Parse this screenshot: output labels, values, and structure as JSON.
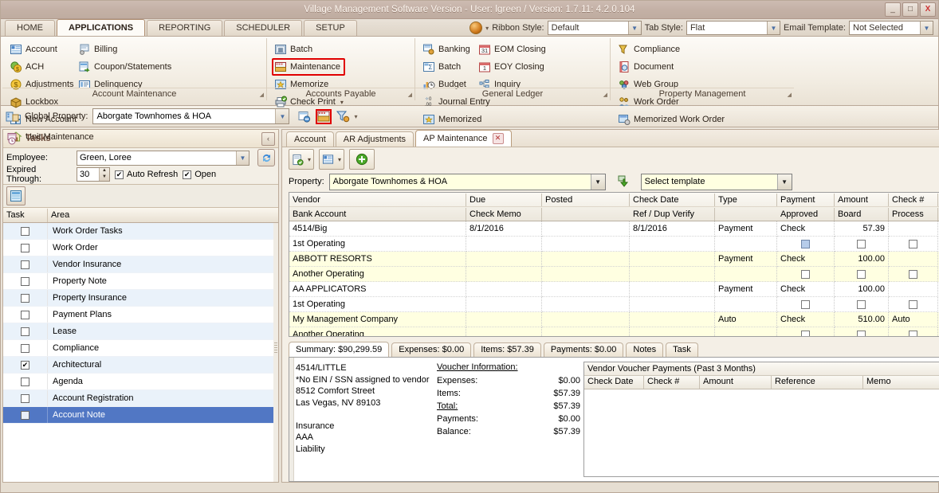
{
  "window": {
    "title": "Village Management Software Version - User: lgreen / Version: 1.7.11: 4.2.0.104",
    "minimize": "_",
    "maximize": "□",
    "close": "X"
  },
  "ribbon_tabs": [
    {
      "label": "HOME",
      "active": false
    },
    {
      "label": "APPLICATIONS",
      "active": true
    },
    {
      "label": "REPORTING",
      "active": false
    },
    {
      "label": "SCHEDULER",
      "active": false
    },
    {
      "label": "SETUP",
      "active": false
    }
  ],
  "ribbon_right": {
    "ribbon_style_label": "Ribbon Style:",
    "ribbon_style_value": "Default",
    "tab_style_label": "Tab Style:",
    "tab_style_value": "Flat",
    "email_template_label": "Email Template:",
    "email_template_value": "Not Selected"
  },
  "ribbon_groups": [
    {
      "title": "Account Maintenance",
      "columns": [
        [
          {
            "label": "Account",
            "icon": "account-icon"
          },
          {
            "label": "ACH",
            "icon": "ach-icon"
          },
          {
            "label": "Adjustments",
            "icon": "adjustments-icon"
          }
        ],
        [
          {
            "label": "Billing",
            "icon": "billing-icon"
          },
          {
            "label": "Coupon/Statements",
            "icon": "coupon-statements-icon"
          },
          {
            "label": "Delinquency",
            "icon": "delinquency-icon"
          }
        ],
        [
          {
            "label": "Lockbox",
            "icon": "lockbox-icon"
          },
          {
            "label": "New Account",
            "icon": "new-account-icon"
          },
          {
            "label": "Unit Maintenance",
            "icon": "unit-maintenance-icon"
          }
        ]
      ]
    },
    {
      "title": "Accounts Payable",
      "columns": [
        [
          {
            "label": "Batch",
            "icon": "batch-icon"
          },
          {
            "label": "Maintenance",
            "icon": "maintenance-icon",
            "highlighted": true
          },
          {
            "label": "Memorize",
            "icon": "memorize-icon"
          }
        ],
        [
          {
            "label": "Check Print",
            "icon": "check-print-icon",
            "caret": true
          }
        ]
      ]
    },
    {
      "title": "General Ledger",
      "columns": [
        [
          {
            "label": "Banking",
            "icon": "banking-icon"
          },
          {
            "label": "Batch",
            "icon": "gl-batch-icon"
          },
          {
            "label": "Budget",
            "icon": "budget-icon"
          }
        ],
        [
          {
            "label": "EOM Closing",
            "icon": "eom-closing-icon"
          },
          {
            "label": "EOY Closing",
            "icon": "eoy-closing-icon"
          },
          {
            "label": "Inquiry",
            "icon": "inquiry-icon"
          }
        ],
        [
          {
            "label": "Journal Entry",
            "icon": "journal-entry-icon"
          },
          {
            "label": "Memorized",
            "icon": "gl-memorized-icon"
          }
        ]
      ]
    },
    {
      "title": "Property Management",
      "columns": [
        [
          {
            "label": "Compliance",
            "icon": "compliance-icon"
          },
          {
            "label": "Document",
            "icon": "document-icon"
          },
          {
            "label": "Web Group",
            "icon": "web-group-icon"
          }
        ],
        [
          {
            "label": "Work Order",
            "icon": "work-order-icon"
          },
          {
            "label": "Memorized Work Order",
            "icon": "memorized-work-order-icon"
          }
        ]
      ]
    }
  ],
  "global_property": {
    "label": "Global Property:",
    "value": "Aborgate Townhomes & HOA"
  },
  "tasks_panel": {
    "title": "Tasks",
    "collapse": "‹",
    "employee_label": "Employee:",
    "employee_value": "Green, Loree",
    "expired_label": "Expired Through:",
    "expired_value": "30",
    "auto_refresh_label": "Auto Refresh",
    "auto_refresh_checked": true,
    "open_label": "Open",
    "open_checked": true,
    "columns": [
      "Task",
      "Area"
    ],
    "rows": [
      {
        "area": "Account Note",
        "checked": false,
        "selected": true
      },
      {
        "area": "Account Registration",
        "checked": false,
        "selected": false
      },
      {
        "area": "Agenda",
        "checked": false,
        "selected": false
      },
      {
        "area": "Architectural",
        "checked": true,
        "selected": false
      },
      {
        "area": "Compliance",
        "checked": false,
        "selected": false
      },
      {
        "area": "Lease",
        "checked": false,
        "selected": false
      },
      {
        "area": "Payment Plans",
        "checked": false,
        "selected": false
      },
      {
        "area": "Property Insurance",
        "checked": false,
        "selected": false
      },
      {
        "area": "Property Note",
        "checked": false,
        "selected": false
      },
      {
        "area": "Vendor Insurance",
        "checked": false,
        "selected": false
      },
      {
        "area": "Work Order",
        "checked": false,
        "selected": false
      },
      {
        "area": "Work Order Tasks",
        "checked": false,
        "selected": false
      }
    ]
  },
  "doc_tabs": [
    {
      "label": "Account",
      "active": false,
      "closable": false
    },
    {
      "label": "AR Adjustments",
      "active": false,
      "closable": false
    },
    {
      "label": "AP Maintenance",
      "active": true,
      "closable": true
    }
  ],
  "ap": {
    "property_label": "Property:",
    "property_value": "Aborgate Townhomes & HOA",
    "template_value": "Select template",
    "grid": {
      "headers_row1": [
        "Vendor",
        "Due",
        "Posted",
        "Check Date",
        "Type",
        "Payment",
        "Amount",
        "Check #"
      ],
      "headers_row2": [
        "Bank Account",
        "Check Memo",
        "",
        "Ref / Dup Verify",
        "",
        "Approved",
        "Board",
        "Process"
      ],
      "rows": [
        {
          "kind": "main",
          "shade": "white",
          "vendor": "4514/Big",
          "due": "8/1/2016",
          "posted": "",
          "check_date": "8/1/2016",
          "type": "Payment",
          "payment": "Check",
          "amount": "57.39",
          "check_no": ""
        },
        {
          "kind": "sub",
          "shade": "white",
          "bank_account": "1st Operating",
          "check_memo": "",
          "ref": "",
          "approved": true,
          "approved_blue": true,
          "board": false,
          "process": false
        },
        {
          "kind": "main",
          "shade": "yellow",
          "vendor": "ABBOTT RESORTS",
          "due": "",
          "posted": "",
          "check_date": "",
          "type": "Payment",
          "payment": "Check",
          "amount": "100.00",
          "check_no": ""
        },
        {
          "kind": "sub",
          "shade": "yellow",
          "bank_account": "Another Operating",
          "check_memo": "",
          "ref": "",
          "approved": false,
          "board": false,
          "process": false
        },
        {
          "kind": "main",
          "shade": "white",
          "vendor": "AA APPLICATORS",
          "due": "",
          "posted": "",
          "check_date": "",
          "type": "Payment",
          "payment": "Check",
          "amount": "100.00",
          "check_no": ""
        },
        {
          "kind": "sub",
          "shade": "white",
          "bank_account": "1st Operating",
          "check_memo": "",
          "ref": "",
          "approved": false,
          "board": false,
          "process": false
        },
        {
          "kind": "main",
          "shade": "yellow",
          "vendor": "My Management Company",
          "due": "",
          "posted": "",
          "check_date": "",
          "type": "Auto",
          "payment": "Check",
          "amount": "510.00",
          "check_no": "Auto"
        },
        {
          "kind": "sub",
          "shade": "yellow",
          "bank_account": "Another Operating",
          "check_memo": "",
          "ref": "",
          "approved": false,
          "board": false,
          "process": false
        }
      ]
    },
    "bottom_tabs": [
      {
        "label": "Summary: $90,299.59",
        "active": true
      },
      {
        "label": "Expenses:  $0.00",
        "active": false
      },
      {
        "label": "Items:  $57.39",
        "active": false
      },
      {
        "label": "Payments: $0.00",
        "active": false
      },
      {
        "label": "Notes",
        "active": false
      },
      {
        "label": "Task",
        "active": false
      }
    ],
    "summary": {
      "vendor_lines": [
        "4514/LITTLE",
        "*No EIN / SSN assigned to vendor",
        "8512 Comfort Street",
        "Las Vegas, NV 89103",
        "",
        "Insurance",
        "AAA",
        "Liability"
      ],
      "voucher_title": "Voucher Information:",
      "voucher_rows": [
        {
          "key": "Expenses:",
          "value": "$0.00",
          "underline": false
        },
        {
          "key": "Items:",
          "value": "$57.39",
          "underline": false
        },
        {
          "key": "Total:",
          "value": "$57.39",
          "underline": true
        },
        {
          "key": "Payments:",
          "value": "$0.00",
          "underline": false
        },
        {
          "key": "Balance:",
          "value": "$57.39",
          "underline": false
        }
      ],
      "payments_title": "Vendor Voucher Payments (Past 3 Months)",
      "payments_headers": [
        "Check Date",
        "Check #",
        "Amount",
        "Reference",
        "Memo"
      ],
      "payments_rows": []
    }
  },
  "colors": {
    "accent_red": "#e00000",
    "selection_blue": "#5177c4",
    "field_yellow": "#ffffe1",
    "titlebar": "#c4b1a6"
  }
}
